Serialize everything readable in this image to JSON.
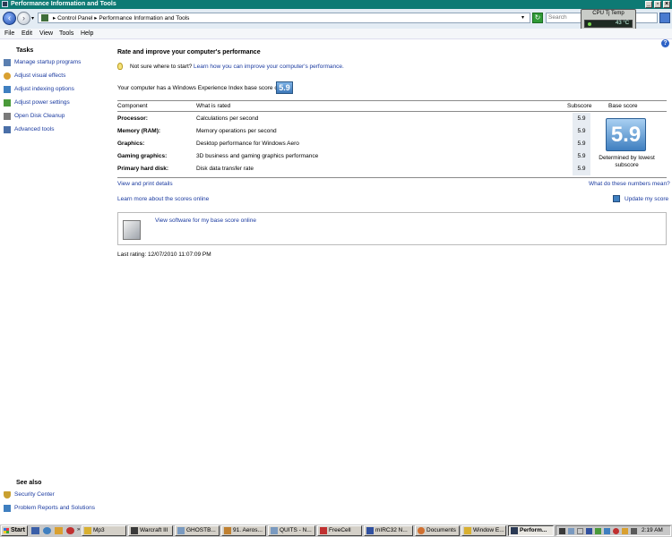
{
  "window": {
    "title": "Performance Information and Tools"
  },
  "address": {
    "crumbs": "▸ Control Panel  ▸ Performance Information and Tools",
    "search_placeholder": "Search"
  },
  "gadget": {
    "title": "CPU Tj Temp",
    "value": "43 °C"
  },
  "menu": [
    "File",
    "Edit",
    "View",
    "Tools",
    "Help"
  ],
  "left": {
    "tasks_heading": "Tasks",
    "tasks": [
      {
        "label": "Manage startup programs",
        "icon": "startup-icon",
        "color": "#5a7fb0"
      },
      {
        "label": "Adjust visual effects",
        "icon": "visual-effects-icon",
        "color": "#d9a030"
      },
      {
        "label": "Adjust indexing options",
        "icon": "indexing-icon",
        "color": "#3f7fc0"
      },
      {
        "label": "Adjust power settings",
        "icon": "power-icon",
        "color": "#4a9a3a"
      },
      {
        "label": "Open Disk Cleanup",
        "icon": "disk-cleanup-icon",
        "color": "#7a7a7a"
      },
      {
        "label": "Advanced tools",
        "icon": "advanced-tools-icon",
        "color": "#4a6fa8"
      }
    ],
    "see_also_heading": "See also",
    "see_also": [
      {
        "label": "Security Center",
        "icon": "shield-icon",
        "color": "#c9a030"
      },
      {
        "label": "Problem Reports and Solutions",
        "icon": "problem-reports-icon",
        "color": "#3f7fc0"
      }
    ]
  },
  "main": {
    "heading": "Rate and improve your computer's performance",
    "not_sure": "Not sure where to start?",
    "learn_how": "Learn how you can improve your computer's performance.",
    "experience_text": "Your computer has a Windows Experience Index base score of",
    "base_score": "5.9",
    "columns": {
      "component": "Component",
      "rated": "What is rated",
      "subscore": "Subscore",
      "base": "Base score"
    },
    "rows": [
      {
        "component": "Processor:",
        "rated": "Calculations per second",
        "subscore": "5.9"
      },
      {
        "component": "Memory (RAM):",
        "rated": "Memory operations per second",
        "subscore": "5.9"
      },
      {
        "component": "Graphics:",
        "rated": "Desktop performance for Windows Aero",
        "subscore": "5.9"
      },
      {
        "component": "Gaming graphics:",
        "rated": "3D business and gaming graphics performance",
        "subscore": "5.9"
      },
      {
        "component": "Primary hard disk:",
        "rated": "Disk data transfer rate",
        "subscore": "5.9"
      }
    ],
    "determined": "Determined by lowest subscore",
    "view_print": "View and print details",
    "what_do": "What do these numbers mean?",
    "learn_more": "Learn more about the scores online",
    "update_score": "Update my score",
    "view_software": "View software for my base score online",
    "last_rating": "Last rating: 12/07/2010 11:07:09 PM"
  },
  "taskbar": {
    "start": "Start",
    "buttons": [
      {
        "label": "Mp3",
        "color": "#d9b030"
      },
      {
        "label": "Warcraft III",
        "color": "#3a3a3a"
      },
      {
        "label": "GHOSTB...",
        "color": "#7a9ac0"
      },
      {
        "label": "91. Aeros...",
        "color": "#c08030"
      },
      {
        "label": "QUITS - N...",
        "color": "#7a9ac0"
      },
      {
        "label": "FreeCell",
        "color": "#c03030"
      },
      {
        "label": "mIRC32 N...",
        "color": "#3050a0"
      },
      {
        "label": "Documents",
        "color": "#d07030"
      },
      {
        "label": "Window E...",
        "color": "#d9b030"
      },
      {
        "label": "Perform...",
        "color": "#2b3a55",
        "active": true
      }
    ],
    "clock": "2:19 AM"
  }
}
